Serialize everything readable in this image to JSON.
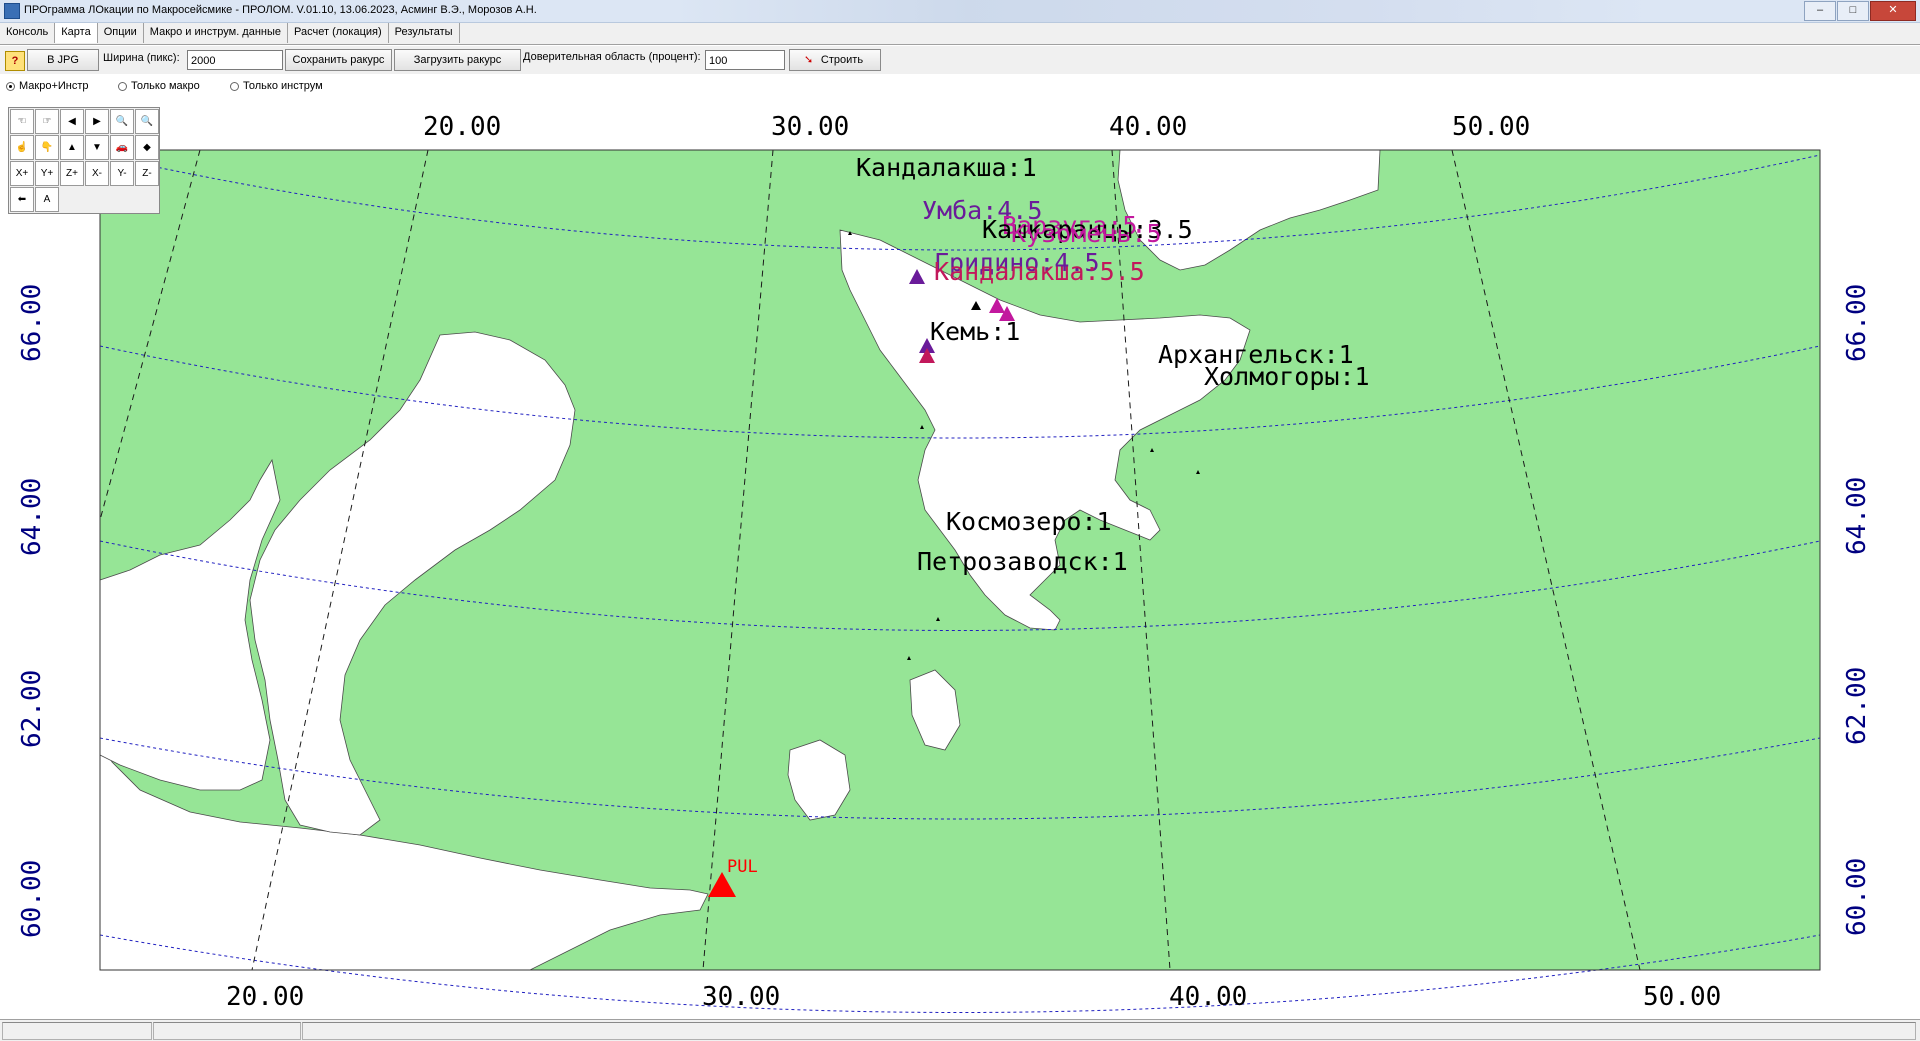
{
  "window": {
    "title": "ПРОграмма ЛОкации по Макросейсмике - ПРОЛОМ. V.01.10, 13.06.2023, Асминг В.Э., Морозов А.Н.",
    "minimize": "–",
    "maximize": "□",
    "close": "✕"
  },
  "tabs": [
    {
      "label": "Консоль"
    },
    {
      "label": "Карта"
    },
    {
      "label": "Опции"
    },
    {
      "label": "Макро и инструм. данные"
    },
    {
      "label": "Расчет (локация)"
    },
    {
      "label": "Результаты"
    }
  ],
  "toolbar": {
    "help": "?",
    "jpg_button": "В JPG",
    "width_label": "Ширина (пикс):",
    "width_value": "2000",
    "save_view": "Сохранить ракурс",
    "load_view": "Загрузить ракурс",
    "confidence_label": "Доверительная область (процент):",
    "confidence_value": "100",
    "build": "Строить"
  },
  "radio_options": [
    {
      "label": "Макро+Инстр",
      "selected": true
    },
    {
      "label": "Только макро",
      "selected": false
    },
    {
      "label": "Только инструм",
      "selected": false
    }
  ],
  "map_tools": [
    {
      "icon": "hand-left-icon",
      "glyph": "☜"
    },
    {
      "icon": "hand-right-icon",
      "glyph": "☞"
    },
    {
      "icon": "arrow-left-icon",
      "glyph": "◀"
    },
    {
      "icon": "arrow-right-icon",
      "glyph": "▶"
    },
    {
      "icon": "zoom-out-icon",
      "glyph": "🔍"
    },
    {
      "icon": "zoom-in-icon",
      "glyph": "🔍"
    },
    {
      "icon": "hand-up-icon",
      "glyph": "☝"
    },
    {
      "icon": "hand-down-icon",
      "glyph": "👇"
    },
    {
      "icon": "arrow-up-icon",
      "glyph": "▲"
    },
    {
      "icon": "arrow-down-icon",
      "glyph": "▼"
    },
    {
      "icon": "car-icon",
      "glyph": "🚗"
    },
    {
      "icon": "eraser-icon",
      "glyph": "◆"
    },
    {
      "icon": "x-plus-icon",
      "glyph": "X+"
    },
    {
      "icon": "y-plus-icon",
      "glyph": "Y+"
    },
    {
      "icon": "z-plus-icon",
      "glyph": "Z+"
    },
    {
      "icon": "x-minus-icon",
      "glyph": "X-"
    },
    {
      "icon": "y-minus-icon",
      "glyph": "Y-"
    },
    {
      "icon": "z-minus-icon",
      "glyph": "Z-"
    },
    {
      "icon": "back-arrow-icon",
      "glyph": "⬅"
    },
    {
      "icon": "text-tool-icon",
      "glyph": "A"
    }
  ],
  "map": {
    "colors": {
      "land": "#96e596",
      "water": "#ffffff",
      "grid": "#00008b",
      "axis_label": "#000080"
    },
    "lon_labels_top": [
      "20.00",
      "30.00",
      "40.00",
      "50.00"
    ],
    "lon_labels_bottom": [
      "20.00",
      "30.00",
      "40.00",
      "50.00"
    ],
    "lat_labels": [
      "60.00",
      "62.00",
      "64.00",
      "66.00"
    ],
    "stations": [
      {
        "label": "Кандалакша:1",
        "color": "#000000"
      },
      {
        "label": "Умба:4.5",
        "color": "#6a1b9a"
      },
      {
        "label": "Варзуга:5",
        "color": "#c2189e"
      },
      {
        "label": "Кашкаранцы:3.5",
        "color": "#000000"
      },
      {
        "label": "Кузомень:5",
        "color": "#c2189e"
      },
      {
        "label": "Гридино:4.5",
        "color": "#6a1b9a"
      },
      {
        "label": "Кандалакша:5.5",
        "color": "#c2185b"
      },
      {
        "label": "Кемь:1",
        "color": "#000000"
      },
      {
        "label": "Архангельск:1",
        "color": "#000000"
      },
      {
        "label": "Холмогоры:1",
        "color": "#000000"
      },
      {
        "label": "Космозеро:1",
        "color": "#000000"
      },
      {
        "label": "Петрозаводск:1",
        "color": "#000000"
      },
      {
        "label": "PUL",
        "color": "#ff0000"
      }
    ]
  }
}
